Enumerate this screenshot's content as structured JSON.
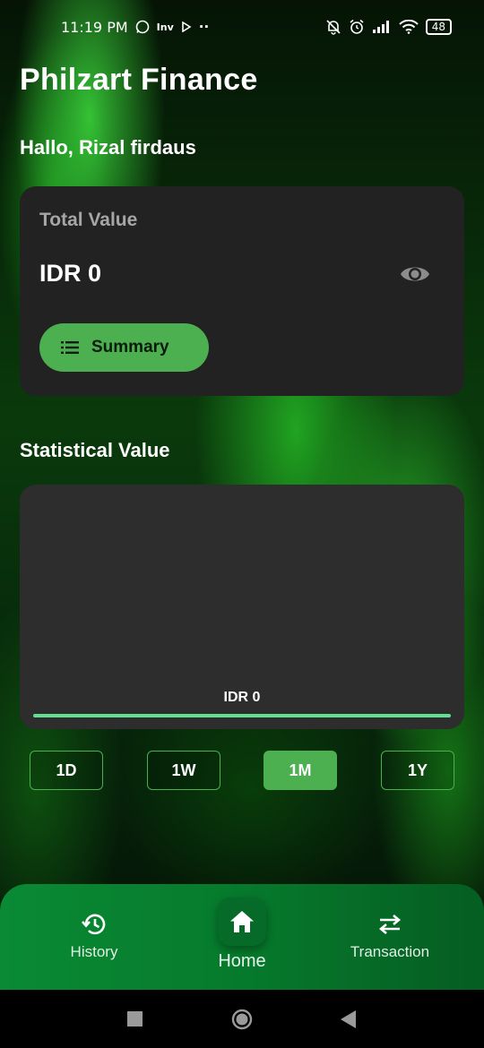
{
  "status_bar": {
    "time": "11:19 PM",
    "left_icons": [
      "whatsapp-icon",
      "inv-icon",
      "play-icon",
      "more-dots-icon"
    ],
    "inv_text": "Inv",
    "dots": "··",
    "battery": "48"
  },
  "app": {
    "title": "Philzart Finance",
    "greeting": "Hallo, Rizal firdaus"
  },
  "total_card": {
    "label": "Total Value",
    "amount": "IDR 0",
    "summary_label": "Summary"
  },
  "stat_section": {
    "title": "Statistical Value",
    "amount": "IDR 0"
  },
  "ranges": {
    "items": [
      "1D",
      "1W",
      "1M",
      "1Y"
    ],
    "active": "1M"
  },
  "bottom_nav": {
    "history": "History",
    "home": "Home",
    "transaction": "Transaction"
  },
  "colors": {
    "accent": "#4caf50",
    "card": "#222222",
    "chart_line": "#5ee090",
    "nav": "#067a2c"
  }
}
